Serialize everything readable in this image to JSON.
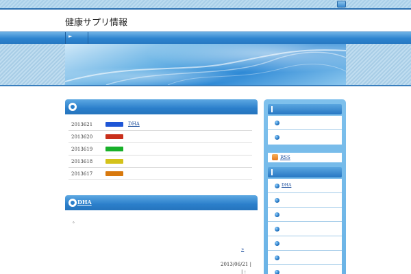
{
  "site": {
    "title": "健康サプリ情報"
  },
  "nav": {
    "home_arrow": "►"
  },
  "news": {
    "items": [
      {
        "date": "2013621",
        "category_color": "#1f56d6",
        "link": "DHA"
      },
      {
        "date": "2013620",
        "category_color": "#c9301c",
        "link": ""
      },
      {
        "date": "2013619",
        "category_color": "#18b02a",
        "link": ""
      },
      {
        "date": "2013618",
        "category_color": "#d4c21a",
        "link": ""
      },
      {
        "date": "2013617",
        "category_color": "#d8790e",
        "link": ""
      }
    ]
  },
  "post": {
    "title": "DHA",
    "excerpt": "。",
    "more": "»",
    "date": "2013/06/21 |",
    "meta": "| :"
  },
  "sidebar": {
    "box1_items": [
      {
        "label": ""
      },
      {
        "label": ""
      }
    ],
    "rss_label": "RSS",
    "box2_items": [
      {
        "label": "DHA"
      },
      {
        "label": ""
      },
      {
        "label": ""
      },
      {
        "label": ""
      },
      {
        "label": ""
      },
      {
        "label": ""
      },
      {
        "label": ""
      }
    ]
  },
  "colors": {
    "accent": "#2b7fcb",
    "link": "#1a4c9c"
  }
}
